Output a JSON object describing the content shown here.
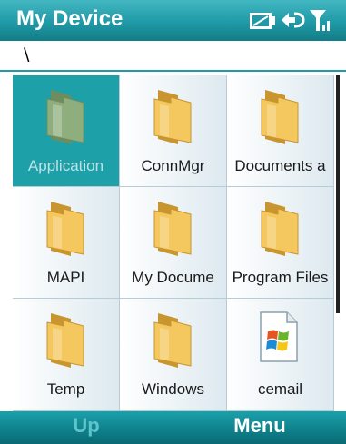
{
  "window": {
    "title": "My Device",
    "status_icons": [
      "battery-icon",
      "connectivity-icon",
      "signal-strength-icon"
    ]
  },
  "path": {
    "value": "\\"
  },
  "items": [
    {
      "label": "Application",
      "icon": "folder-icon",
      "selected": true
    },
    {
      "label": "ConnMgr",
      "icon": "folder-icon",
      "selected": false
    },
    {
      "label": "Documents a",
      "icon": "folder-icon",
      "selected": false
    },
    {
      "label": "MAPI",
      "icon": "folder-icon",
      "selected": false
    },
    {
      "label": "My Docume",
      "icon": "folder-icon",
      "selected": false
    },
    {
      "label": "Program Files",
      "icon": "folder-icon",
      "selected": false
    },
    {
      "label": "Temp",
      "icon": "folder-icon",
      "selected": false
    },
    {
      "label": "Windows",
      "icon": "folder-icon",
      "selected": false
    },
    {
      "label": "cemail",
      "icon": "windows-file-icon",
      "selected": false
    }
  ],
  "softkeys": {
    "left": "Up",
    "right": "Menu"
  },
  "colors": {
    "accent": "#1ea0a9",
    "folder": "#f4c75f",
    "selected_folder": "#8fae7e"
  }
}
